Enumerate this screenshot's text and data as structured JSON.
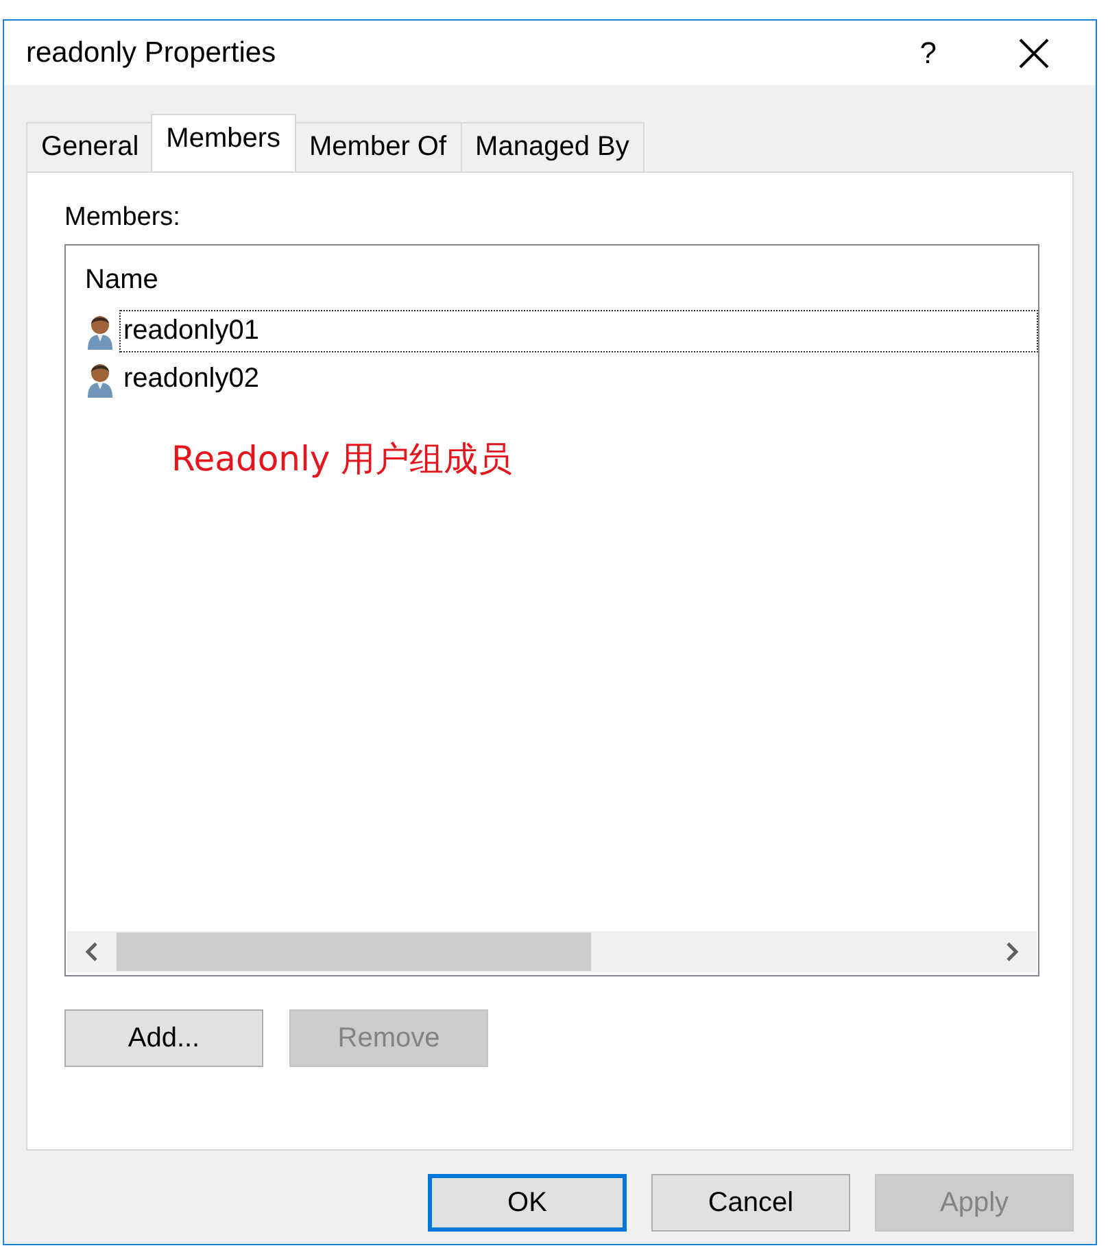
{
  "window": {
    "title": "readonly Properties",
    "help_button": "?"
  },
  "tabs": [
    {
      "label": "General",
      "selected": false
    },
    {
      "label": "Members",
      "selected": true
    },
    {
      "label": "Member Of",
      "selected": false
    },
    {
      "label": "Managed By",
      "selected": false
    }
  ],
  "members_label": "Members:",
  "list": {
    "columns": [
      "Name"
    ],
    "rows": [
      {
        "name": "readonly01",
        "selected": true
      },
      {
        "name": "readonly02",
        "selected": false
      }
    ]
  },
  "annotation": "Readonly 用户组成员",
  "list_buttons": [
    {
      "label": "Add...",
      "disabled": false
    },
    {
      "label": "Remove",
      "disabled": true
    }
  ],
  "dialog_buttons": [
    {
      "label": "OK",
      "default": true,
      "disabled": false
    },
    {
      "label": "Cancel",
      "default": false,
      "disabled": false
    },
    {
      "label": "Apply",
      "default": false,
      "disabled": true
    }
  ]
}
